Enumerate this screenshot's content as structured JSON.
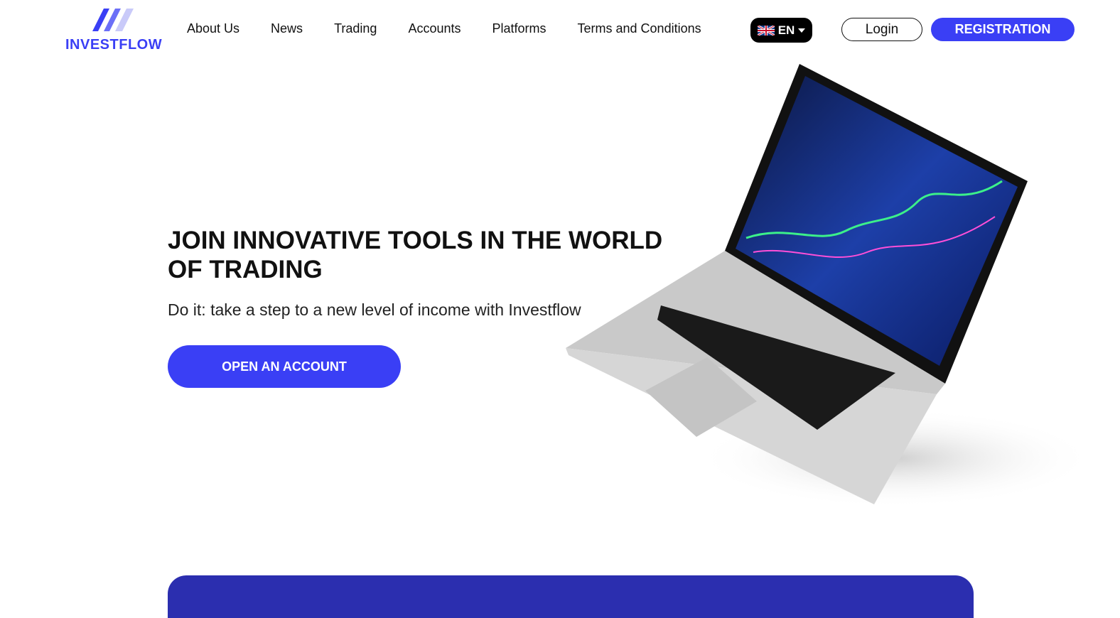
{
  "brand": {
    "name": "INVESTFLOW",
    "color": "#3a3ff5"
  },
  "nav": {
    "items": [
      "About Us",
      "News",
      "Trading",
      "Accounts",
      "Platforms",
      "Terms and Conditions"
    ]
  },
  "lang": {
    "label": "EN",
    "flag": "uk-flag-icon"
  },
  "auth": {
    "login": "Login",
    "register": "REGISTRATION"
  },
  "hero": {
    "title": "JOIN INNOVATIVE TOOLS IN THE WORLD OF TRADING",
    "subtitle": "Do it: take a step to a new level of income with Investflow",
    "cta": "OPEN AN ACCOUNT"
  },
  "colors": {
    "accent": "#3a3ff5",
    "band": "#2b2eaf"
  }
}
